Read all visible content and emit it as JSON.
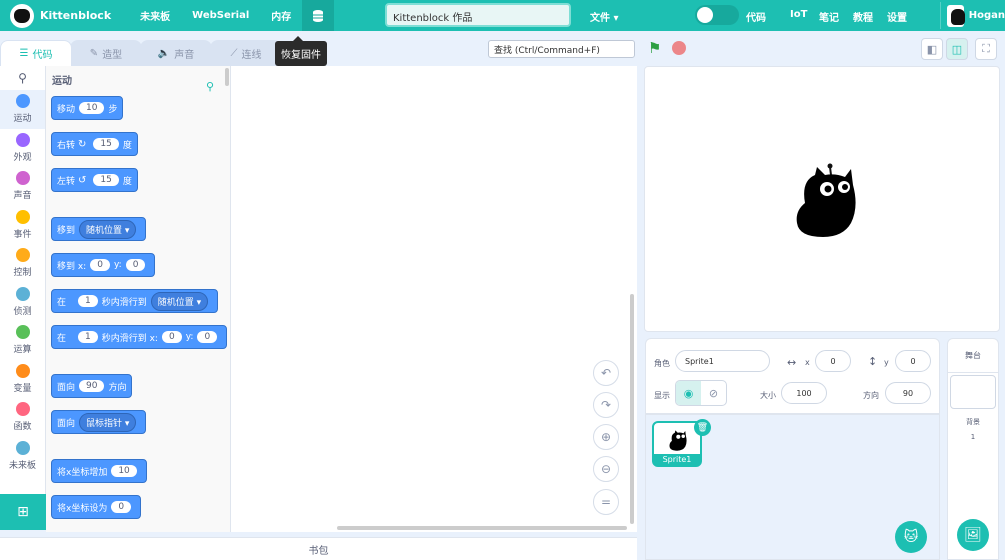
{
  "menubar": {
    "logo_text": "Kittenblock",
    "items": [
      "未来板",
      "WebSerial",
      "内存"
    ],
    "project_title": "Kittenblock 作品",
    "file_menu": "文件 ▾",
    "code_label": "代码",
    "iot": "IoT",
    "notes": "笔记",
    "tutorials": "教程",
    "settings": "设置",
    "username": "Hogan"
  },
  "tabs": [
    "代码",
    "造型",
    "声音",
    "连线"
  ],
  "tooltip": "恢复固件",
  "find_placeholder": "查找 (Ctrl/Command+F)",
  "categories": [
    {
      "label": "运动",
      "color": "#4c97ff"
    },
    {
      "label": "外观",
      "color": "#9966ff"
    },
    {
      "label": "声音",
      "color": "#cf63cf"
    },
    {
      "label": "事件",
      "color": "#ffbf00"
    },
    {
      "label": "控制",
      "color": "#ffab19"
    },
    {
      "label": "侦测",
      "color": "#5cb1d6"
    },
    {
      "label": "运算",
      "color": "#59c059"
    },
    {
      "label": "变量",
      "color": "#ff8c1a"
    },
    {
      "label": "函数",
      "color": "#ff6680"
    },
    {
      "label": "未来板",
      "color": "#5cb1d6"
    }
  ],
  "palette": {
    "title": "运动",
    "blocks": {
      "move": {
        "a": "移动",
        "v": "10",
        "b": "步"
      },
      "turn_right": {
        "a": "右转",
        "v": "15",
        "b": "度"
      },
      "turn_left": {
        "a": "左转",
        "v": "15",
        "b": "度"
      },
      "goto": {
        "a": "移到",
        "dd": "随机位置 ▾"
      },
      "gotoxy": {
        "a": "移到 x:",
        "x": "0",
        "ylabel": "y:",
        "y": "0"
      },
      "glide": {
        "a": "在",
        "v": "1",
        "b": "秒内滑行到",
        "dd": "随机位置 ▾"
      },
      "glidexy": {
        "a": "在",
        "v": "1",
        "b": "秒内滑行到 x:",
        "x": "0",
        "ylabel": "y:",
        "y": "0"
      },
      "point": {
        "a": "面向",
        "v": "90",
        "b": "方向"
      },
      "pointto": {
        "a": "面向",
        "dd": "鼠标指针 ▾"
      },
      "changex": {
        "a": "将x坐标增加",
        "v": "10"
      },
      "setx": {
        "a": "将x坐标设为",
        "v": "0"
      }
    }
  },
  "backpack": "书包",
  "sprite": {
    "role_label": "角色",
    "name": "Sprite1",
    "x_label": "x",
    "x": "0",
    "y_label": "y",
    "y": "0",
    "show_label": "显示",
    "size_label": "大小",
    "size": "100",
    "direction_label": "方向",
    "direction": "90",
    "thumb_name": "Sprite1"
  },
  "stage_pane": {
    "title": "舞台",
    "backdrop_label": "背景",
    "backdrop_count": "1"
  }
}
